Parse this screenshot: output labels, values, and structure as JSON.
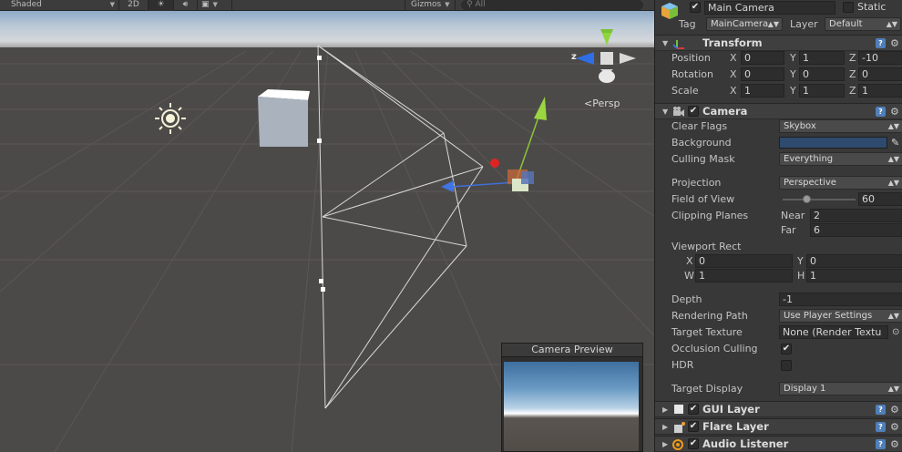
{
  "scene": {
    "toolbar": {
      "shading_mode": "Shaded",
      "mode_2d": "2D",
      "gizmos": "Gizmos",
      "search_placeholder": "All"
    },
    "persp_label": "Persp",
    "axis_z": "z",
    "camera_preview_title": "Camera Preview"
  },
  "inspector": {
    "object_name": "Main Camera",
    "active": true,
    "static_label": "Static",
    "tag_label": "Tag",
    "tag_value": "MainCamera",
    "layer_label": "Layer",
    "layer_value": "Default",
    "transform": {
      "title": "Transform",
      "position_label": "Position",
      "rotation_label": "Rotation",
      "scale_label": "Scale",
      "axes": [
        "X",
        "Y",
        "Z"
      ],
      "position": [
        "0",
        "1",
        "-10"
      ],
      "rotation": [
        "0",
        "0",
        "0"
      ],
      "scale": [
        "1",
        "1",
        "1"
      ]
    },
    "camera": {
      "title": "Camera",
      "clear_flags_label": "Clear Flags",
      "clear_flags_value": "Skybox",
      "background_label": "Background",
      "background_color": "#2e4a6e",
      "culling_mask_label": "Culling Mask",
      "culling_mask_value": "Everything",
      "projection_label": "Projection",
      "projection_value": "Perspective",
      "fov_label": "Field of View",
      "fov_value": "60",
      "fov_fraction": 0.33,
      "clipping_label": "Clipping Planes",
      "near_label": "Near",
      "near_value": "2",
      "far_label": "Far",
      "far_value": "6",
      "viewport_label": "Viewport Rect",
      "vp_x_label": "X",
      "vp_x": "0",
      "vp_y_label": "Y",
      "vp_y": "0",
      "vp_w_label": "W",
      "vp_w": "1",
      "vp_h_label": "H",
      "vp_h": "1",
      "depth_label": "Depth",
      "depth_value": "-1",
      "rendering_path_label": "Rendering Path",
      "rendering_path_value": "Use Player Settings",
      "target_texture_label": "Target Texture",
      "target_texture_value": "None (Render Textu",
      "occlusion_label": "Occlusion Culling",
      "occlusion_checked": true,
      "hdr_label": "HDR",
      "hdr_checked": false,
      "target_display_label": "Target Display",
      "target_display_value": "Display 1"
    },
    "components": [
      {
        "title": "GUI Layer",
        "icon": "gui-layer-icon",
        "enabled": true
      },
      {
        "title": "Flare Layer",
        "icon": "flare-layer-icon",
        "enabled": true
      },
      {
        "title": "Audio Listener",
        "icon": "audio-listener-icon",
        "enabled": true
      }
    ]
  }
}
